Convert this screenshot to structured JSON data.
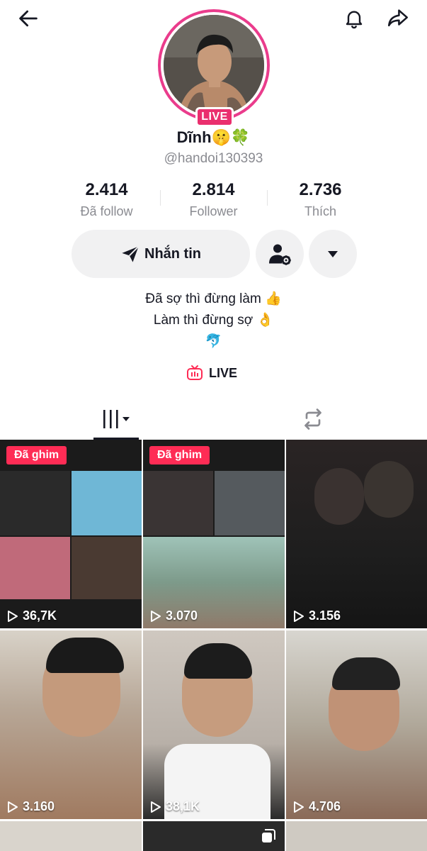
{
  "header": {
    "back_icon": "arrow-left-icon",
    "bell_icon": "bell-icon",
    "share_icon": "share-arrow-icon"
  },
  "profile": {
    "live_badge": "LIVE",
    "name": "Dĩnh🤫🍀",
    "username": "@handoi130393",
    "ring_color": "#ea3c8c"
  },
  "stats": [
    {
      "value": "2.414",
      "label": "Đã follow"
    },
    {
      "value": "2.814",
      "label": "Follower"
    },
    {
      "value": "2.736",
      "label": "Thích"
    }
  ],
  "actions": {
    "message_label": "Nhắn tin",
    "message_icon": "send-icon",
    "friend_icon": "user-settings-icon",
    "more_icon": "caret-down-icon"
  },
  "bio": {
    "line1": "Đã sợ thì đừng làm 👍",
    "line2": "Làm thì đừng sợ 👌",
    "line3": "🐬"
  },
  "live_link": {
    "label": "LIVE",
    "icon": "tv-icon",
    "icon_color": "#fe2c55"
  },
  "tabs": {
    "videos_icon": "grid-lines-icon",
    "reposts_icon": "repost-icon"
  },
  "videos": [
    {
      "pinned": "Đã ghim",
      "views": "36,7K"
    },
    {
      "pinned": "Đã ghim",
      "views": "3.070"
    },
    {
      "pinned": "",
      "views": "3.156"
    },
    {
      "pinned": "",
      "views": "3.160"
    },
    {
      "pinned": "",
      "views": "38,1K"
    },
    {
      "pinned": "",
      "views": "4.706"
    }
  ],
  "colors": {
    "accent": "#fe2c55",
    "text": "#161823",
    "muted": "#8a8b91",
    "button_bg": "#f1f1f2"
  }
}
